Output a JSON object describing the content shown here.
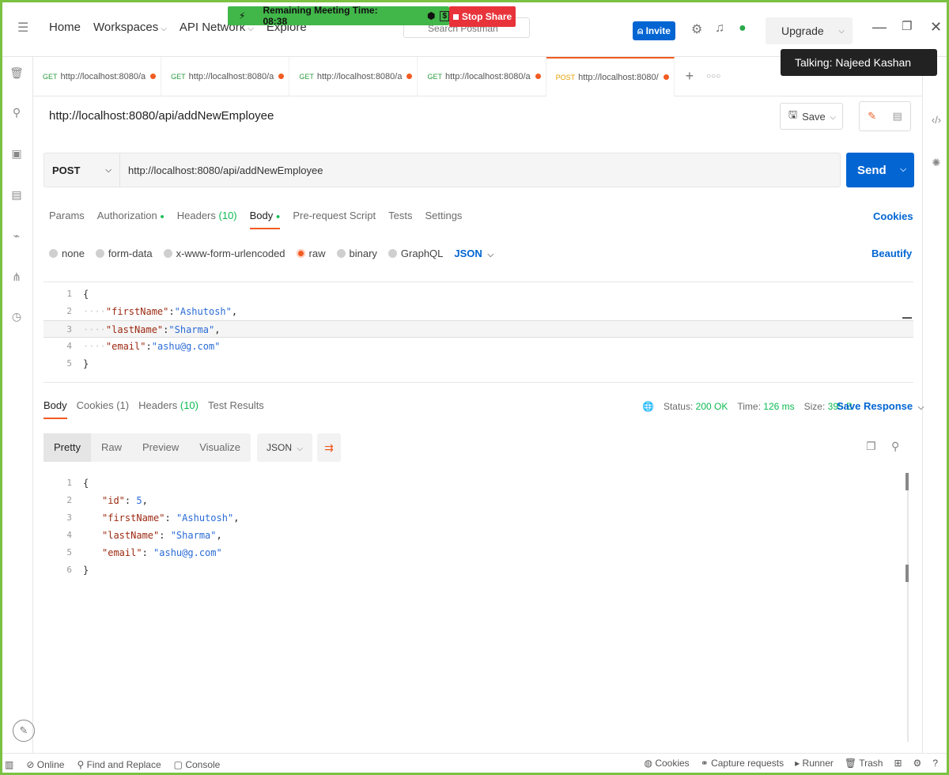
{
  "app": {
    "nav": [
      "Home",
      "Workspaces",
      "API Network",
      "Explore"
    ],
    "search_placeholder": "Search Postman",
    "invite_label": "Invite",
    "upgrade_label": "Upgrade"
  },
  "meeting": {
    "remaining_label": "Remaining Meeting Time: 08:38",
    "stop_share_label": "Stop Share",
    "talking_label": "Talking: Najeed Kashan"
  },
  "tabs": [
    {
      "method": "GET",
      "url": "http://localhost:8080/a",
      "active": false
    },
    {
      "method": "GET",
      "url": "http://localhost:8080/a",
      "active": false
    },
    {
      "method": "GET",
      "url": "http://localhost:8080/a",
      "active": false
    },
    {
      "method": "GET",
      "url": "http://localhost:8080/a",
      "active": false
    },
    {
      "method": "POST",
      "url": "http://localhost:8080/",
      "active": true
    }
  ],
  "request": {
    "title": "http://localhost:8080/api/addNewEmployee",
    "save_label": "Save",
    "method": "POST",
    "url": "http://localhost:8080/api/addNewEmployee",
    "send_label": "Send",
    "subtabs": [
      "Params",
      "Authorization",
      "Headers",
      "Body",
      "Pre-request Script",
      "Tests",
      "Settings"
    ],
    "headers_count": "(10)",
    "cookies_label": "Cookies",
    "body_types": [
      "none",
      "form-data",
      "x-www-form-urlencoded",
      "raw",
      "binary",
      "GraphQL"
    ],
    "body_format": "JSON",
    "beautify_label": "Beautify",
    "body_lines": [
      {
        "n": "1",
        "text": "{"
      },
      {
        "n": "2",
        "key": "\"firstName\"",
        "sep": ":",
        "val": "\"Ashutosh\"",
        "end": ","
      },
      {
        "n": "3",
        "key": "\"lastName\"",
        "sep": ":",
        "val": "\"Sharma\"",
        "end": ","
      },
      {
        "n": "4",
        "key": "\"email\"",
        "sep": ":",
        "val": "\"ashu@g.com\"",
        "end": ""
      },
      {
        "n": "5",
        "text": "}"
      }
    ]
  },
  "response": {
    "tabs": [
      "Body",
      "Cookies (1)",
      "Headers",
      "Test Results"
    ],
    "headers_count": "(10)",
    "status_label": "Status:",
    "status_value": "200 OK",
    "time_label": "Time:",
    "time_value": "126 ms",
    "size_label": "Size:",
    "size_value": "395 B",
    "save_response_label": "Save Response",
    "view_tabs": [
      "Pretty",
      "Raw",
      "Preview",
      "Visualize"
    ],
    "format": "JSON",
    "lines": [
      {
        "n": "1",
        "text": "{"
      },
      {
        "n": "2",
        "key": "\"id\"",
        "sep": ": ",
        "val": "5",
        "end": ","
      },
      {
        "n": "3",
        "key": "\"firstName\"",
        "sep": ": ",
        "val": "\"Ashutosh\"",
        "end": ","
      },
      {
        "n": "4",
        "key": "\"lastName\"",
        "sep": ": ",
        "val": "\"Sharma\"",
        "end": ","
      },
      {
        "n": "5",
        "key": "\"email\"",
        "sep": ": ",
        "val": "\"ashu@g.com\"",
        "end": ""
      },
      {
        "n": "6",
        "text": "}"
      }
    ]
  },
  "statusbar": {
    "online": "Online",
    "find_replace": "Find and Replace",
    "console": "Console",
    "cookies": "Cookies",
    "capture": "Capture requests",
    "runner": "Runner",
    "trash": "Trash"
  },
  "colors": {
    "accent": "#f15b22",
    "primary": "#0265d2",
    "success": "#0cbb52",
    "frame": "#7bc142"
  }
}
